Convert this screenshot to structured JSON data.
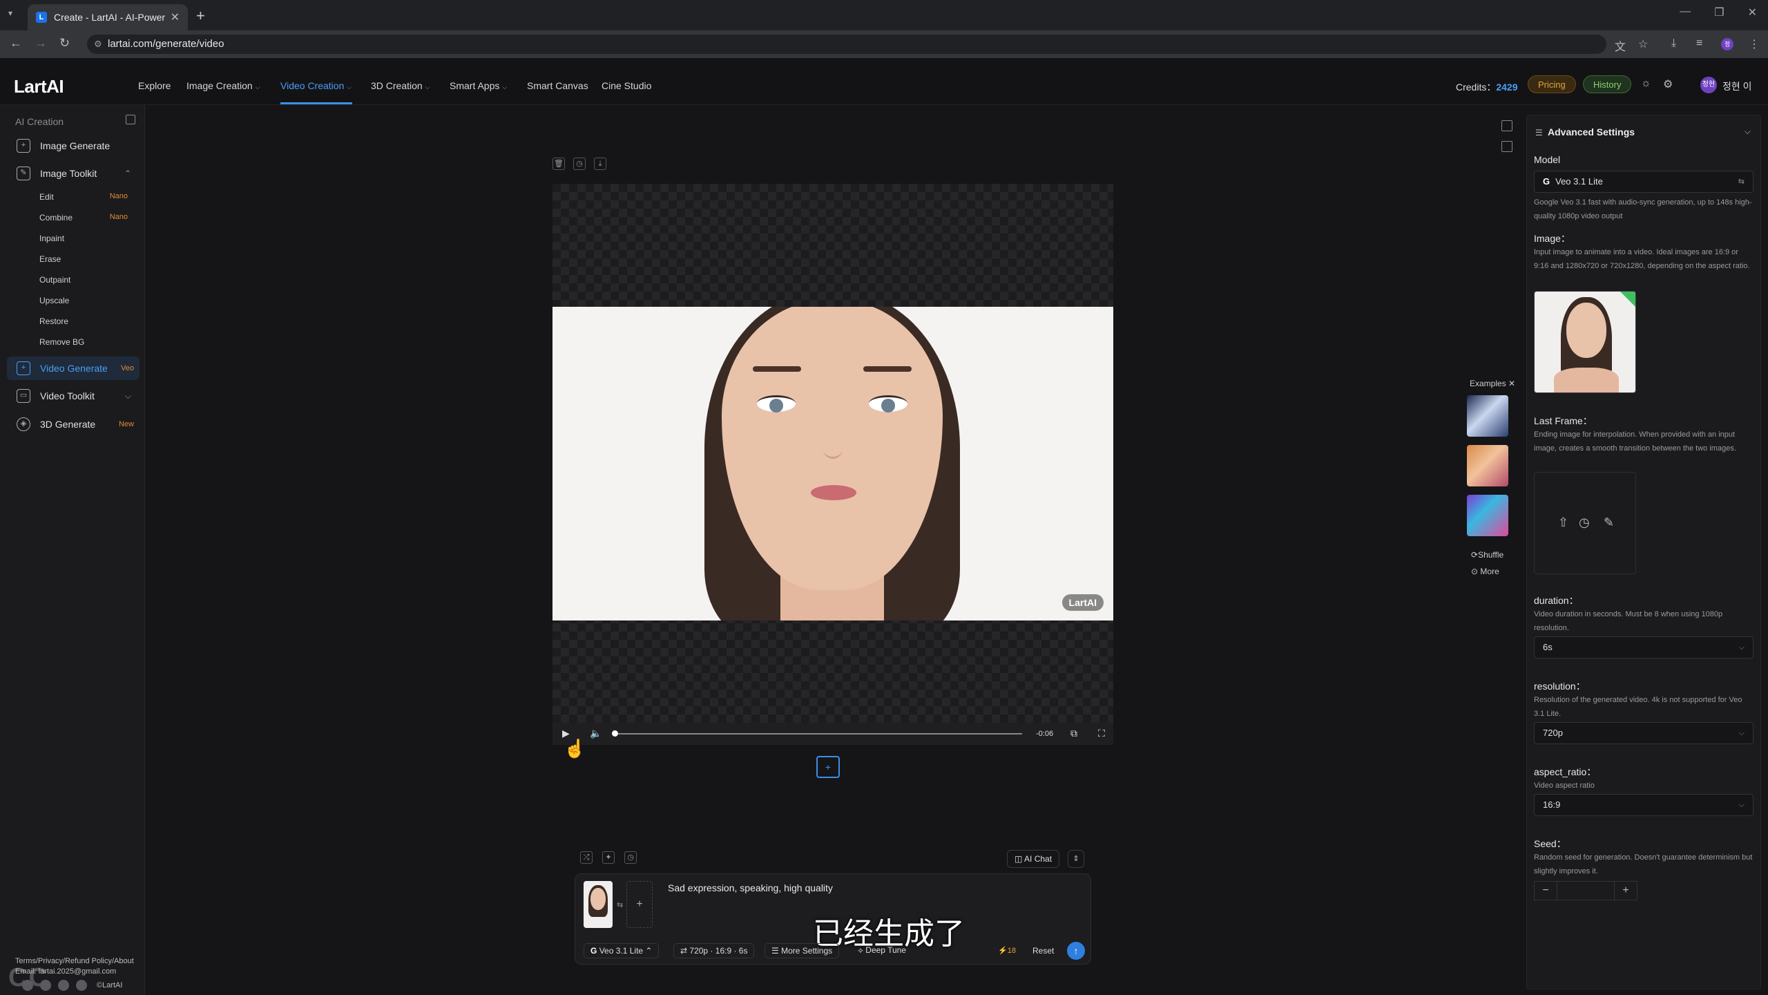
{
  "browser": {
    "tab_title": "Create - LartAI - AI-Powered C",
    "tab_favicon": "L",
    "url": "lartai.com/generate/video"
  },
  "header": {
    "logo": "LartAI",
    "nav": [
      "Explore",
      "Image Creation",
      "Video Creation",
      "3D Creation",
      "Smart Apps",
      "Smart Canvas",
      "Cine Studio"
    ],
    "credits_label": "Credits：",
    "credits_value": "2429",
    "pricing": "Pricing",
    "history": "History",
    "avatar_text": "정현",
    "username": "정현 이"
  },
  "sidebar": {
    "heading": "AI Creation",
    "image_generate": "Image Generate",
    "image_toolkit": "Image Toolkit",
    "sub": [
      {
        "label": "Edit",
        "tag": "Nano"
      },
      {
        "label": "Combine",
        "tag": "Nano"
      },
      {
        "label": "Inpaint",
        "tag": ""
      },
      {
        "label": "Erase",
        "tag": ""
      },
      {
        "label": "Outpaint",
        "tag": ""
      },
      {
        "label": "Upscale",
        "tag": ""
      },
      {
        "label": "Restore",
        "tag": ""
      },
      {
        "label": "Remove BG",
        "tag": ""
      }
    ],
    "video_generate": "Video Generate",
    "video_generate_tag": "Veo",
    "video_toolkit": "Video Toolkit",
    "generate_3d": "3D Generate",
    "generate_3d_tag": "New",
    "footer_line1": "Terms/Privacy/Refund Policy/About",
    "footer_line2": "Email: lartai.2025@gmail.com",
    "copyright": "©LartAI",
    "watermark": "CC"
  },
  "player": {
    "watermark": "LartAI",
    "time": "-0:06",
    "progress": 0.0
  },
  "composer": {
    "prompt": "Sad expression, speaking, high quality",
    "subtitle_overlay": "已经生成了",
    "model_chip": "Veo 3.1 Lite",
    "spec_chip": "720p · 16:9 · 6s",
    "more_settings": "More Settings",
    "deep_tune": "Deep Tune",
    "cost": "18",
    "reset": "Reset",
    "ai_chat": "AI Chat"
  },
  "examples": {
    "title": "Examples",
    "shuffle": "Shuffle",
    "more": "More"
  },
  "settings": {
    "title": "Advanced Settings",
    "model_label": "Model",
    "model_value": "Veo 3.1 Lite",
    "model_desc": "Google Veo 3.1 fast with audio-sync generation, up to 148s high-quality 1080p video output",
    "image_label": "Image：",
    "image_desc": "Input image to animate into a video. Ideal images are 16:9 or 9:16 and 1280x720 or 720x1280, depending on the aspect ratio.",
    "last_frame_label": "Last Frame：",
    "last_frame_desc": "Ending image for interpolation. When provided with an input image, creates a smooth transition between the two images.",
    "duration_label": "duration：",
    "duration_desc": "Video duration in seconds. Must be 8 when using 1080p resolution.",
    "duration_value": "6s",
    "resolution_label": "resolution：",
    "resolution_desc": "Resolution of the generated video. 4k is not supported for Veo 3.1 Lite.",
    "resolution_value": "720p",
    "aspect_label": "aspect_ratio：",
    "aspect_desc": "Video aspect ratio",
    "aspect_value": "16:9",
    "seed_label": "Seed：",
    "seed_desc": "Random seed for generation. Doesn't guarantee determinism but slightly improves it.",
    "seed_value": ""
  },
  "colors": {
    "accent": "#3b8fe8",
    "pricing": "#e3a33a",
    "history": "#8bd067"
  }
}
